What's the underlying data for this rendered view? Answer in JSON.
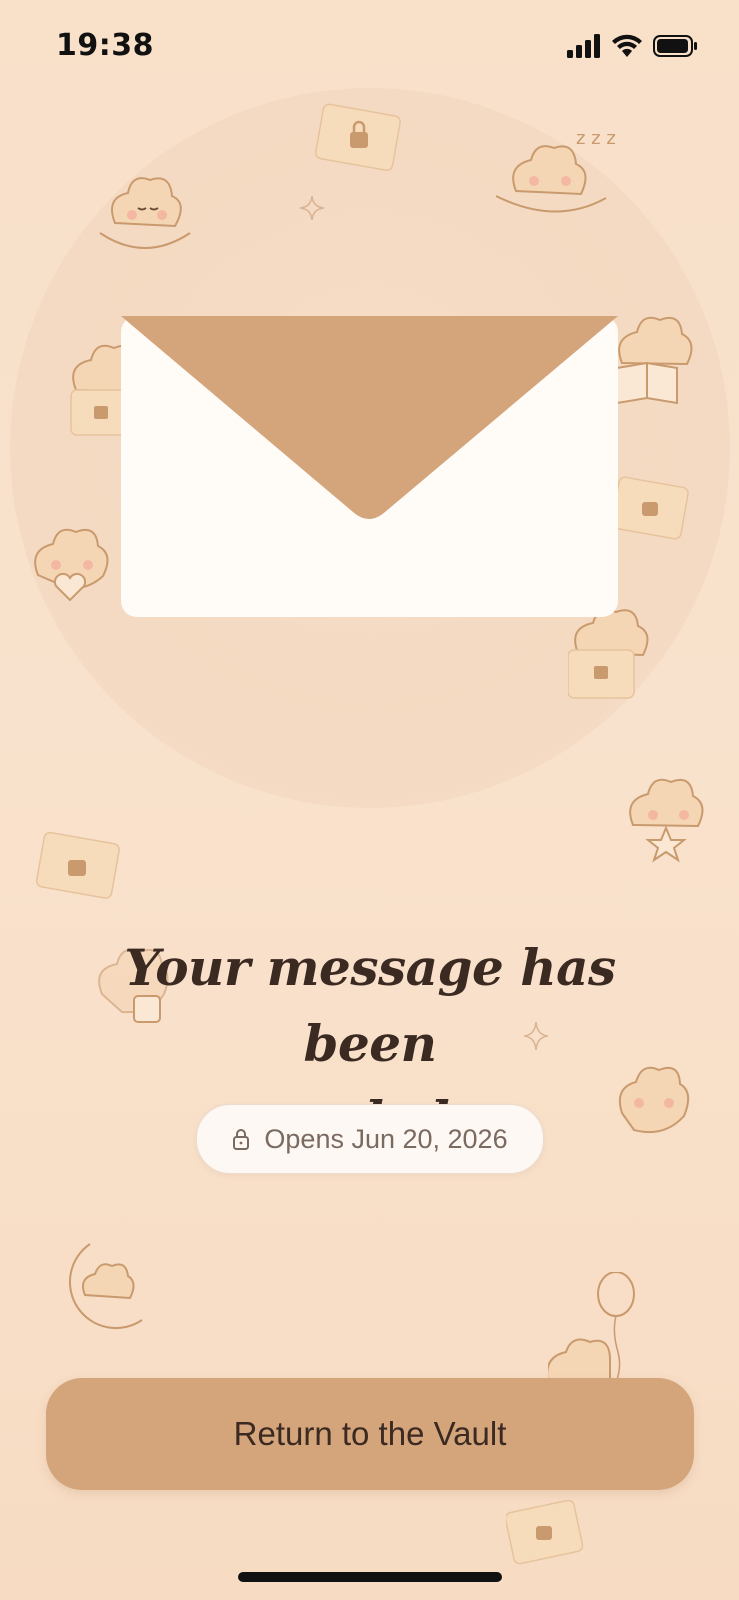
{
  "status_bar": {
    "time": "19:38",
    "icons": [
      "cellular-signal-icon",
      "wifi-icon",
      "battery-icon"
    ]
  },
  "envelope": {
    "icon": "envelope-icon",
    "flap_color": "#d4a47b",
    "body_color": "#fffbf7"
  },
  "headline": {
    "line1": "Your message has been",
    "line2": "sealed."
  },
  "opens_badge": {
    "icon": "lock-icon",
    "label": "Opens Jun 20, 2026"
  },
  "return_button": {
    "label": "Return to the Vault",
    "color": "#d4a47b"
  },
  "colors": {
    "background": "#f8e0c9",
    "text": "#3b2a22",
    "accent": "#d4a47b"
  },
  "decorations": [
    "cloud-meditating",
    "cloud-sleeping",
    "cloud-reading",
    "cloud-holding-envelope",
    "cloud-holding-heart",
    "cloud-holding-star",
    "cloud-with-mug",
    "cloud-praying",
    "cloud-on-moon",
    "cloud-with-balloon",
    "locked-envelope",
    "sparkle"
  ]
}
